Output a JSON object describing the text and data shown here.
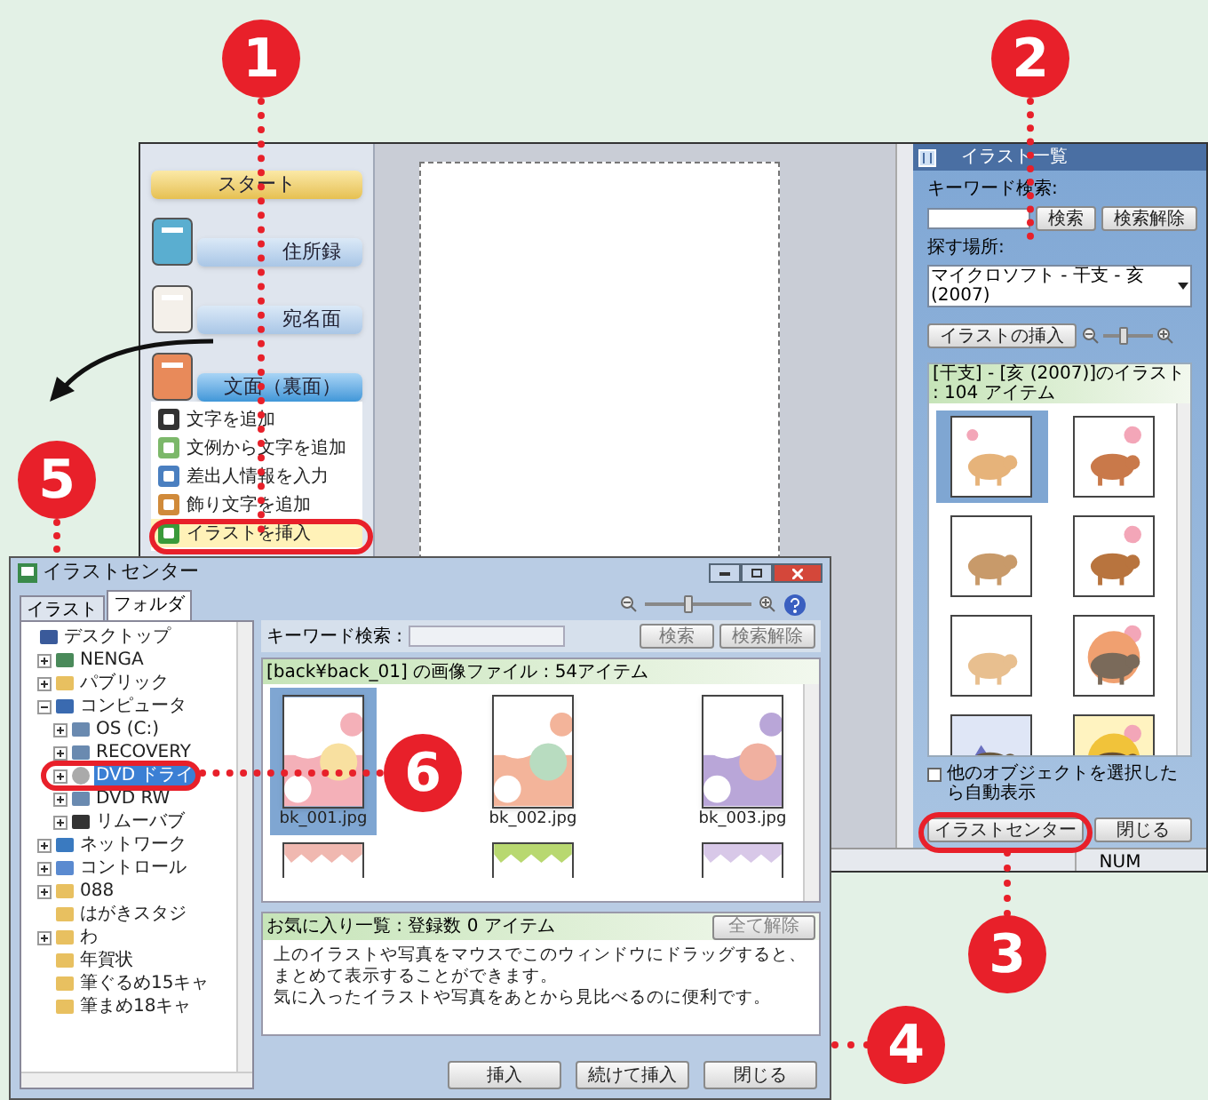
{
  "callouts": [
    {
      "label": "1"
    },
    {
      "label": "2"
    },
    {
      "label": "3"
    },
    {
      "label": "4"
    },
    {
      "label": "5"
    },
    {
      "label": "6"
    }
  ],
  "sidebar": {
    "sections": [
      {
        "label": "スタート",
        "kind": "start"
      },
      {
        "label": "住所録",
        "kind": "address"
      },
      {
        "label": "宛名面",
        "kind": "front"
      },
      {
        "label": "文面（裏面）",
        "kind": "back"
      }
    ],
    "items": [
      {
        "label": "文字を追加",
        "kind": "text",
        "selected": false
      },
      {
        "label": "文例から文字を追加",
        "kind": "sample",
        "selected": false
      },
      {
        "label": "差出人情報を入力",
        "kind": "sender",
        "selected": false
      },
      {
        "label": "飾り文字を追加",
        "kind": "deco",
        "selected": false
      },
      {
        "label": "イラストを挿入",
        "kind": "illust",
        "selected": true
      }
    ]
  },
  "illustration_panel": {
    "title": "イラスト一覧",
    "keyword_label": "キーワード検索:",
    "search_button": "検索",
    "clear_button": "検索解除",
    "location_label": "探す場所:",
    "location_value": "マイクロソフト - 干支 - 亥 (2007)",
    "insert_button": "イラストの挿入",
    "zoom": {
      "level": 0.4
    },
    "list_header": "[干支] - [亥 (2007)]のイラスト : 104 アイテム",
    "thumbnails": [
      {
        "selected": true
      },
      {
        "selected": false
      },
      {
        "selected": false
      },
      {
        "selected": false
      },
      {
        "selected": false
      },
      {
        "selected": false
      },
      {
        "selected": false
      },
      {
        "selected": false
      }
    ],
    "auto_show": {
      "label": "他のオブジェクトを選択したら自動表示",
      "checked": false
    },
    "center_button": "イラストセンター",
    "close_button": "閉じる"
  },
  "status_bar": {
    "indicator": "NUM"
  },
  "center_window": {
    "title": "イラストセンター",
    "tabs": [
      {
        "label": "イラスト",
        "selected": false
      },
      {
        "label": "フォルダ",
        "selected": true
      }
    ],
    "tree": [
      {
        "label": "デスクトップ",
        "kind": "desktop",
        "selected": false,
        "children": [
          {
            "label": "NENGA",
            "kind": "app",
            "expanded": false,
            "selected": false
          },
          {
            "label": "パブリック",
            "kind": "folder",
            "expanded": false,
            "selected": false
          },
          {
            "label": "コンピュータ",
            "kind": "computer",
            "expanded": true,
            "selected": false,
            "children": [
              {
                "label": "OS (C:)",
                "kind": "drive",
                "expanded": false,
                "selected": false
              },
              {
                "label": "RECOVERY",
                "kind": "drive",
                "expanded": false,
                "selected": false
              },
              {
                "label": "DVD ドライ",
                "kind": "disc",
                "expanded": false,
                "selected": true
              },
              {
                "label": "DVD RW",
                "kind": "drive",
                "expanded": false,
                "selected": false
              },
              {
                "label": "リムーバブ",
                "kind": "removable",
                "expanded": false,
                "selected": false
              }
            ]
          },
          {
            "label": "ネットワーク",
            "kind": "network",
            "expanded": false,
            "selected": false
          },
          {
            "label": "コントロール",
            "kind": "control",
            "expanded": false,
            "selected": false
          },
          {
            "label": "088",
            "kind": "folder",
            "expanded": false,
            "selected": false
          },
          {
            "label": "はがきスタジ",
            "kind": "folder",
            "selected": false
          },
          {
            "label": "わ",
            "kind": "folder",
            "expanded": false,
            "selected": false
          },
          {
            "label": "年賀状",
            "kind": "folder",
            "selected": false
          },
          {
            "label": "筆ぐるめ15キャ",
            "kind": "folder",
            "selected": false
          },
          {
            "label": "筆まめ18キャ",
            "kind": "folder",
            "selected": false
          }
        ]
      }
    ],
    "keyword_label": "キーワード検索 :",
    "search_button": "検索",
    "clear_button": "検索解除",
    "zoom": {
      "level": 0.4
    },
    "list_header": "[back¥back_01] の画像ファイル : 54アイテム",
    "files": [
      {
        "name": "bk_001.jpg",
        "selected": true
      },
      {
        "name": "bk_002.jpg",
        "selected": false
      },
      {
        "name": "bk_003.jpg",
        "selected": false
      }
    ],
    "favorites": {
      "header": "お気に入り一覧 : 登録数 0 アイテム",
      "clear_all_button": "全て解除",
      "message": "上のイラストや写真をマウスでこのウィンドウにドラッグすると、まとめて表示することができます。",
      "message_2": "気に入ったイラストや写真をあとから見比べるのに便利です。"
    },
    "buttons": [
      {
        "label": "挿入"
      },
      {
        "label": "続けて挿入"
      },
      {
        "label": "閉じる"
      }
    ]
  }
}
